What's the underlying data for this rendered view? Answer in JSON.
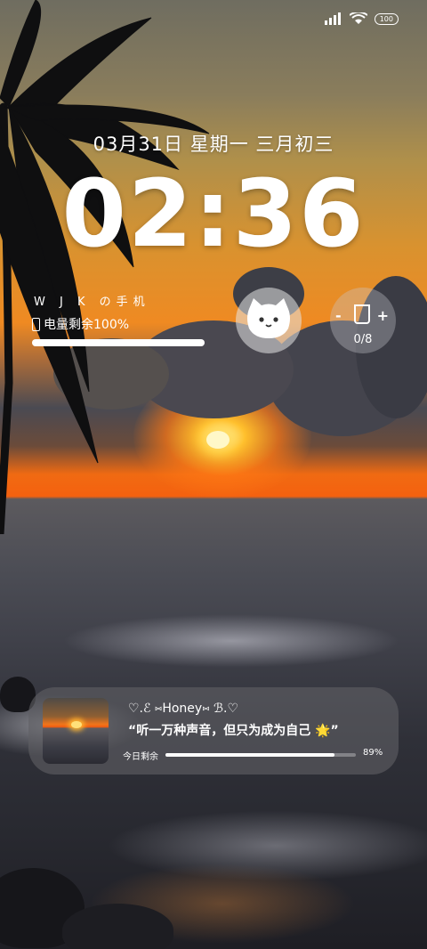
{
  "status_bar": {
    "battery_level": "100",
    "icons": [
      "signal-icon",
      "wifi-icon",
      "battery-icon"
    ]
  },
  "lockscreen": {
    "date": "03月31日 星期一 三月初三",
    "time": "02:36"
  },
  "device_widget": {
    "name": "W  J  K の手机",
    "battery_text": "电量剩余100%",
    "battery_fraction": 1.0
  },
  "pet_widget": {
    "icon": "cat-icon"
  },
  "water_widget": {
    "minus": "-",
    "plus": "+",
    "count": "0/8",
    "icon": "cup-icon"
  },
  "music_widget": {
    "artist": "♡.ℰ ⑅Honey⑅ ℬ.♡",
    "lyric": "“听一万种声音，但只为成为自己 🌟”",
    "progress_label": "今日剩余",
    "progress_text": "89%",
    "progress_fraction": 0.89
  },
  "colors": {
    "sky_orange": "#ef8a22",
    "sunset_red": "#f5610f",
    "sea": "#3f4049"
  }
}
